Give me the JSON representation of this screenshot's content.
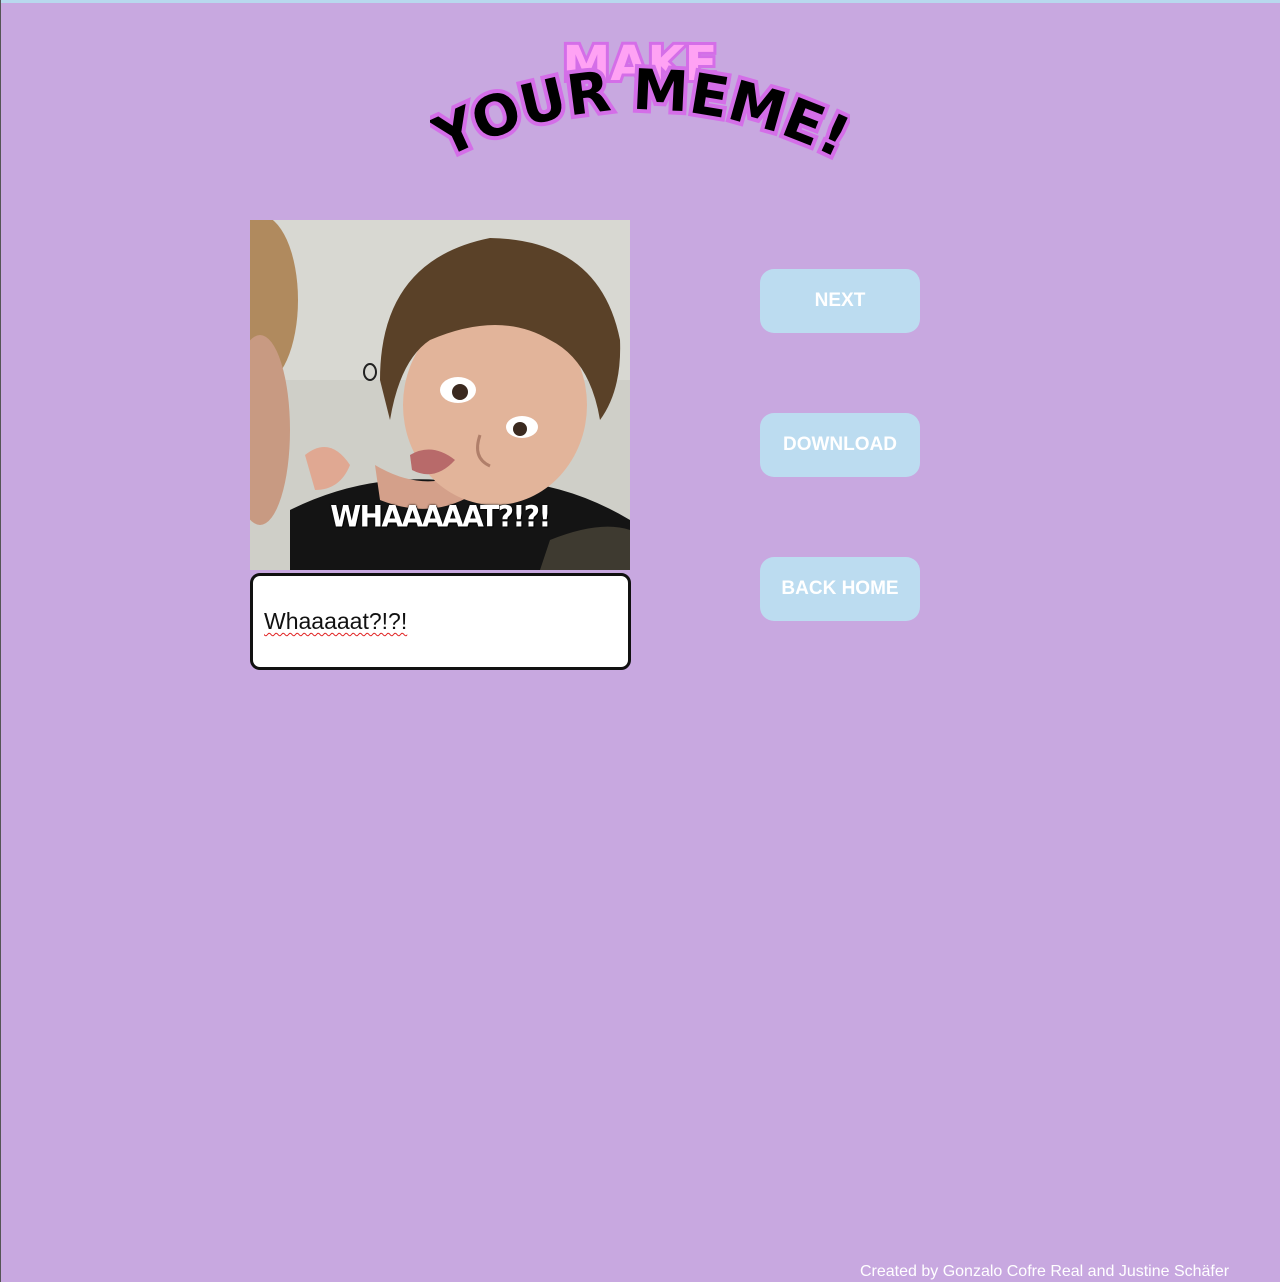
{
  "logo": {
    "line1": "MAKE",
    "line2": "YOUR MEME!",
    "colors": {
      "line1_fill": "#ffa2f4",
      "line2_fill": "#000000",
      "outline": "#d46ee8"
    }
  },
  "meme": {
    "caption_overlay": "WHAAAAAT?!?!",
    "caption_input_value": "Whaaaaat?!?!"
  },
  "buttons": {
    "next": "NEXT",
    "download": "DOWNLOAD",
    "back_home": "BACK HOME"
  },
  "footer": {
    "credit": "Created by Gonzalo Cofre Real and Justine Schäfer"
  },
  "colors": {
    "background": "#c8a8e0",
    "button_bg": "#bcdcf0",
    "button_text": "#ffffff"
  }
}
